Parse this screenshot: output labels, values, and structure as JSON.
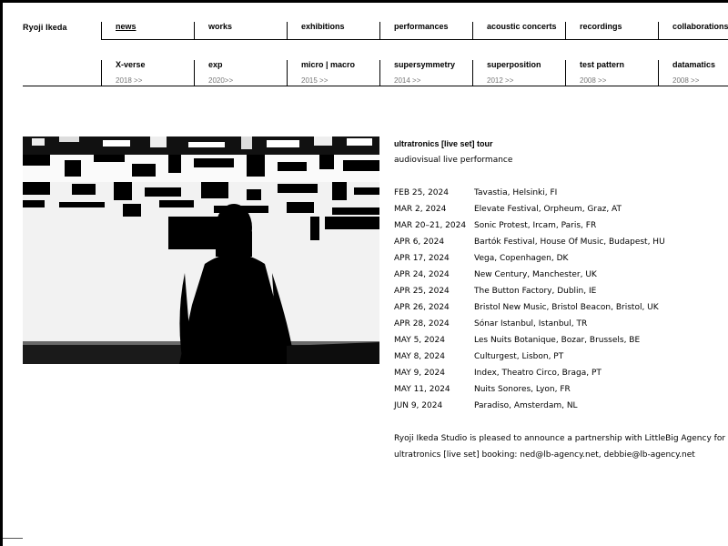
{
  "site": {
    "title": "Ryoji Ikeda"
  },
  "nav_primary": [
    {
      "label": "news",
      "active": true
    },
    {
      "label": "works"
    },
    {
      "label": "exhibitions"
    },
    {
      "label": "performances"
    },
    {
      "label": "acoustic concerts"
    },
    {
      "label": "recordings"
    },
    {
      "label": "collaborations"
    }
  ],
  "nav_secondary": [
    {
      "label": "X-verse",
      "year": "2018 >>"
    },
    {
      "label": "exp",
      "year": "2020>>"
    },
    {
      "label": "micro | macro",
      "year": "2015 >>"
    },
    {
      "label": "supersymmetry",
      "year": "2014 >>"
    },
    {
      "label": "superposition",
      "year": "2012 >>"
    },
    {
      "label": "test pattern",
      "year": "2008 >>"
    },
    {
      "label": "datamatics",
      "year": "2008 >>"
    }
  ],
  "feature": {
    "image": "performance-silhouette-photo",
    "title": "ultratronics [live set] tour",
    "subtitle": "audiovisual live performance",
    "dates": [
      {
        "date": "FEB 25, 2024",
        "venue": "Tavastia, Helsinki, FI"
      },
      {
        "date": "MAR 2, 2024",
        "venue": "Elevate Festival, Orpheum, Graz, AT"
      },
      {
        "date": "MAR 20–21, 2024",
        "venue": "Sonic Protest, Ircam, Paris, FR"
      },
      {
        "date": "APR 6, 2024",
        "venue": "Bartók Festival, House Of Music, Budapest, HU"
      },
      {
        "date": "APR 17, 2024",
        "venue": "Vega, Copenhagen, DK"
      },
      {
        "date": "APR 24, 2024",
        "venue": "New Century, Manchester, UK"
      },
      {
        "date": "APR 25, 2024",
        "venue": "The Button Factory, Dublin, IE"
      },
      {
        "date": "APR 26, 2024",
        "venue": "Bristol New Music, Bristol Beacon, Bristol, UK"
      },
      {
        "date": "APR 28, 2024",
        "venue": "Sónar Istanbul, Istanbul, TR"
      },
      {
        "date": "MAY 5, 2024",
        "venue": "Les Nuits Botanique, Bozar, Brussels, BE"
      },
      {
        "date": "MAY 8, 2024",
        "venue": "Culturgest, Lisbon, PT"
      },
      {
        "date": "MAY 9, 2024",
        "venue": "Index, Theatro Circo, Braga, PT"
      },
      {
        "date": "MAY 11, 2024",
        "venue": "Nuits Sonores, Lyon, FR"
      },
      {
        "date": "JUN 9, 2024",
        "venue": "Paradiso, Amsterdam, NL"
      }
    ],
    "announcement": "Ryoji Ikeda Studio is pleased to announce a partnership with LittleBig Agency for the",
    "booking": "ultratronics [live set] booking: ned@lb-agency.net, debbie@lb-agency.net"
  }
}
